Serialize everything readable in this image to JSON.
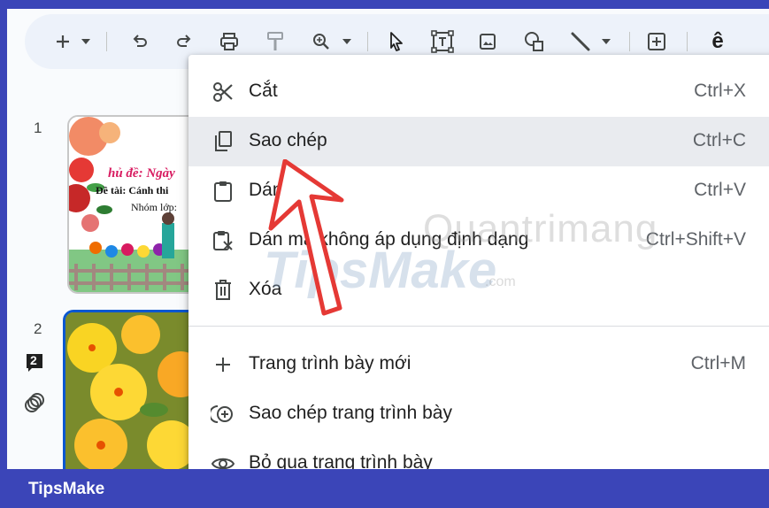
{
  "toolbar": {
    "icons": [
      "plus-icon",
      "chevron-down-icon",
      "undo-icon",
      "redo-icon",
      "print-icon",
      "paint-format-icon",
      "zoom-icon",
      "chevron-down-icon",
      "select-cursor-icon",
      "text-box-icon",
      "image-icon",
      "shape-icon",
      "line-icon",
      "chevron-down-icon",
      "add-comment-icon"
    ],
    "truncated_text": "ê"
  },
  "slides": [
    {
      "number": "1",
      "title_fragment": "hủ đề: Ngày",
      "subtitle_fragment": "Đề tài: Cánh thi",
      "group_fragment": "Nhóm lớp:"
    },
    {
      "number": "2"
    }
  ],
  "side_badges": {
    "comment_count": "2"
  },
  "context_menu": {
    "items": [
      {
        "icon": "scissors-icon",
        "label": "Cắt",
        "shortcut": "Ctrl+X"
      },
      {
        "icon": "copy-icon",
        "label": "Sao chép",
        "shortcut": "Ctrl+C"
      },
      {
        "icon": "clipboard-icon",
        "label": "Dán",
        "shortcut": "Ctrl+V"
      },
      {
        "icon": "paste-no-format-icon",
        "label": "Dán mà không áp dụng định dạng",
        "shortcut": "Ctrl+Shift+V"
      },
      {
        "icon": "trash-icon",
        "label": "Xóa",
        "shortcut": ""
      },
      {
        "icon": "plus-icon",
        "label": "Trang trình bày mới",
        "shortcut": "Ctrl+M"
      },
      {
        "icon": "duplicate-slide-icon",
        "label": "Sao chép trang trình bày",
        "shortcut": ""
      },
      {
        "icon": "eye-icon",
        "label": "Bỏ qua trang trình bày",
        "shortcut": ""
      }
    ],
    "hovered_index": 1
  },
  "watermark": {
    "brand_a": "Quantrimang",
    "brand_b": "TipsMake",
    "domain_suffix": ".com"
  },
  "footer": {
    "label": "TipsMake"
  },
  "colors": {
    "frame": "#3b45b8",
    "toolbar_bg": "#edf2fa",
    "hover_bg": "#e9ebef",
    "selected_slide_border": "#0b57d0",
    "arrow_red": "#e53935"
  }
}
